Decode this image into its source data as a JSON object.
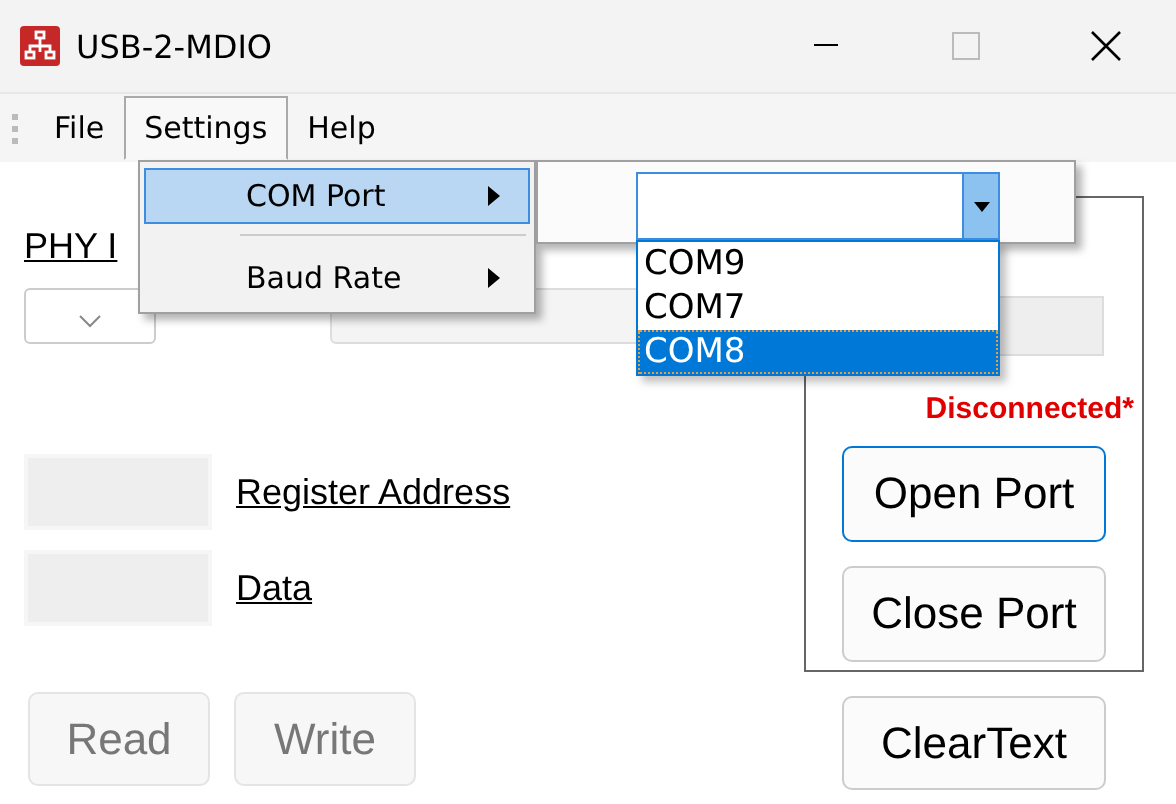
{
  "window": {
    "title": "USB-2-MDIO"
  },
  "menu": [
    {
      "label": "File",
      "selected": false
    },
    {
      "label": "Settings",
      "selected": true
    },
    {
      "label": "Help",
      "selected": false
    }
  ],
  "settings_menu": [
    {
      "label": "COM Port",
      "selected": true
    },
    {
      "label": "Baud Rate",
      "selected": false
    }
  ],
  "com_port_list": [
    {
      "label": "COM9",
      "selected": false
    },
    {
      "label": "COM7",
      "selected": false
    },
    {
      "label": "COM8",
      "selected": true
    }
  ],
  "form": {
    "phy_label": "PHY I",
    "register_address_label": "Register Address",
    "data_label": "Data",
    "buttons": [
      {
        "label": "Read",
        "disabled": true
      },
      {
        "label": "Write",
        "disabled": true
      }
    ]
  },
  "port_group": {
    "status_text": "Disconnected*",
    "open_button": "Open Port",
    "close_button": "Close Port"
  },
  "clear_button": "ClearText"
}
